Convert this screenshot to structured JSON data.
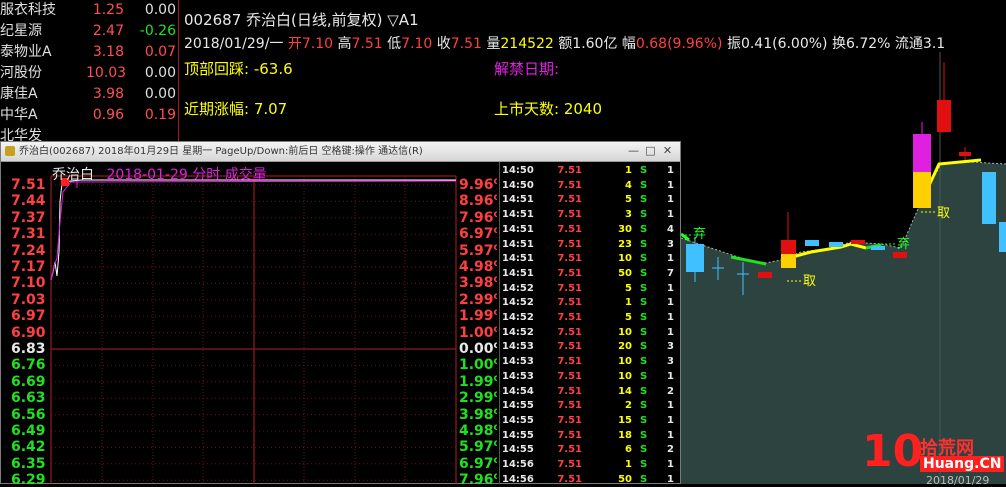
{
  "stock_list": [
    {
      "name": "服衣科技",
      "price": "1.25",
      "change": "0.00",
      "change_color": "#e0e0e0"
    },
    {
      "name": "纪星源",
      "price": "2.47",
      "change": "-0.26",
      "change_color": "#20e020"
    },
    {
      "name": "泰物业A",
      "price": "3.18",
      "change": "0.07",
      "change_color": "#ff5050"
    },
    {
      "name": "河股份",
      "price": "10.03",
      "change": "0.00",
      "change_color": "#e0e0e0"
    },
    {
      "name": "康佳A",
      "price": "3.98",
      "change": "0.00",
      "change_color": "#e0e0e0"
    },
    {
      "name": "中华A",
      "price": "0.96",
      "change": "0.19",
      "change_color": "#ff5050"
    },
    {
      "name": "北华发",
      "price": "",
      "change": "",
      "change_color": "#e0e0e0"
    }
  ],
  "header": {
    "title": "002687 乔治白(日线,前复权) ▽A1",
    "date": "2018/01/29/一",
    "open_label": "开",
    "open": "7.10",
    "high_label": "高",
    "high": "7.51",
    "low_label": "低",
    "low": "7.10",
    "close_label": "收",
    "close": "7.51",
    "vol_label": "量",
    "vol": "214522",
    "amt_label": "额",
    "amt": "1.60亿",
    "chg_label": "幅",
    "chg": "0.68(9.96%)",
    "amp_label": "振",
    "amp": "0.41(6.00%)",
    "turn_label": "换",
    "turn": "6.72%",
    "float_label": "流通",
    "float": "3.1"
  },
  "indicators": {
    "top_label": "顶部回踩: ",
    "top_value": "-63.6",
    "unlock_label": "解禁日期: ",
    "recent_label": "近期涨幅: ",
    "recent_value": "7.07",
    "days_label": "上市天数: ",
    "days_value": "2040"
  },
  "kchart": {
    "markers": [
      "弃",
      "取",
      "弃",
      "取"
    ]
  },
  "dialog": {
    "title": "乔治白(002687) 2018年01月29日 星期一 PageUp/Down:前后日 空格键:操作 通达信(R)",
    "chart_title": "乔治白",
    "chart_date": "2018-01-29",
    "chart_mode": "分时 成交量",
    "price_labels": [
      "7.51",
      "7.44",
      "7.37",
      "7.31",
      "7.24",
      "7.17",
      "7.10",
      "7.03",
      "6.97",
      "6.90",
      "6.83",
      "6.76",
      "6.69",
      "6.63",
      "6.56",
      "6.49",
      "6.42",
      "6.35",
      "6.29"
    ],
    "pct_labels": [
      "9.96%",
      "8.96%",
      "7.96%",
      "6.97%",
      "5.97%",
      "4.98%",
      "3.98%",
      "2.99%",
      "1.99%",
      "1.00%",
      "0.00%",
      "1.00%",
      "1.99%",
      "2.99%",
      "3.98%",
      "4.98%",
      "5.97%",
      "6.97%",
      "7.96%"
    ],
    "ticks": [
      {
        "t": "14:50",
        "p": "7.51",
        "v": "1",
        "s": "S",
        "n": "1"
      },
      {
        "t": "14:50",
        "p": "7.51",
        "v": "4",
        "s": "S",
        "n": "1"
      },
      {
        "t": "14:51",
        "p": "7.51",
        "v": "5",
        "s": "S",
        "n": "1"
      },
      {
        "t": "14:51",
        "p": "7.51",
        "v": "3",
        "s": "S",
        "n": "1"
      },
      {
        "t": "14:51",
        "p": "7.51",
        "v": "30",
        "s": "S",
        "n": "4"
      },
      {
        "t": "14:51",
        "p": "7.51",
        "v": "23",
        "s": "S",
        "n": "3"
      },
      {
        "t": "14:51",
        "p": "7.51",
        "v": "10",
        "s": "S",
        "n": "1"
      },
      {
        "t": "14:51",
        "p": "7.51",
        "v": "50",
        "s": "S",
        "n": "7"
      },
      {
        "t": "14:52",
        "p": "7.51",
        "v": "5",
        "s": "S",
        "n": "1"
      },
      {
        "t": "14:52",
        "p": "7.51",
        "v": "1",
        "s": "S",
        "n": "1"
      },
      {
        "t": "14:52",
        "p": "7.51",
        "v": "5",
        "s": "S",
        "n": "1"
      },
      {
        "t": "14:52",
        "p": "7.51",
        "v": "10",
        "s": "S",
        "n": "1"
      },
      {
        "t": "14:53",
        "p": "7.51",
        "v": "20",
        "s": "S",
        "n": "3"
      },
      {
        "t": "14:53",
        "p": "7.51",
        "v": "10",
        "s": "S",
        "n": "3"
      },
      {
        "t": "14:53",
        "p": "7.51",
        "v": "10",
        "s": "S",
        "n": "1"
      },
      {
        "t": "14:54",
        "p": "7.51",
        "v": "14",
        "s": "S",
        "n": "2"
      },
      {
        "t": "14:55",
        "p": "7.51",
        "v": "2",
        "s": "S",
        "n": "1"
      },
      {
        "t": "14:55",
        "p": "7.51",
        "v": "15",
        "s": "S",
        "n": "1"
      },
      {
        "t": "14:55",
        "p": "7.51",
        "v": "18",
        "s": "S",
        "n": "1"
      },
      {
        "t": "14:55",
        "p": "7.51",
        "v": "6",
        "s": "S",
        "n": "2"
      },
      {
        "t": "14:56",
        "p": "7.51",
        "v": "1",
        "s": "S",
        "n": "1"
      },
      {
        "t": "14:56",
        "p": "7.51",
        "v": "50",
        "s": "S",
        "n": "1"
      },
      {
        "t": "14:56",
        "p": "7.51",
        "v": "1",
        "s": "S",
        "n": "1"
      }
    ]
  },
  "watermark": {
    "number": "10",
    "cn": "拾荒网",
    "url": "Huang.CN",
    "sub": "2018/01/29"
  },
  "colors": {
    "up": "#ff4040",
    "down": "#20e020",
    "flat": "#e8e8e8",
    "accent_yellow": "#ffff00",
    "magenta": "#e020e0"
  }
}
